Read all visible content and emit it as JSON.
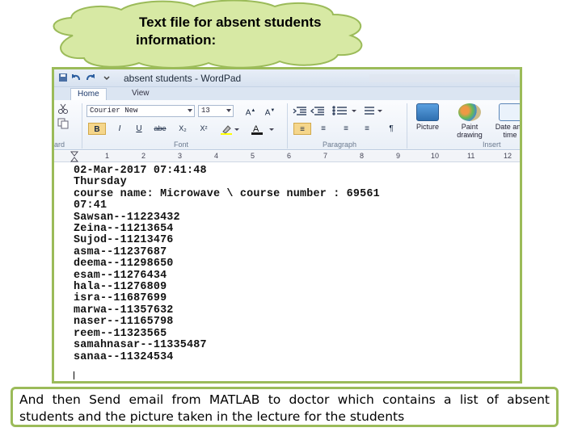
{
  "callout": {
    "title": "Text file for absent students information:"
  },
  "screenshot": {
    "window_title": "absent students - WordPad",
    "tabs": [
      "Home",
      "View"
    ],
    "font_name": "Courier New",
    "font_size": "13",
    "format_buttons": [
      "B",
      "I",
      "U",
      "abe",
      "X₂",
      "X²"
    ],
    "group_labels": {
      "clipboard": "ard",
      "font": "Font",
      "paragraph": "Paragraph",
      "insert": "Insert"
    },
    "insert_buttons": [
      "Picture",
      "Paint drawing",
      "Date and time"
    ],
    "ruler_numbers": [
      "1",
      "2",
      "3",
      "4",
      "5",
      "6",
      "7",
      "8",
      "9",
      "10",
      "11",
      "12"
    ],
    "document_lines": [
      "02-Mar-2017 07:41:48",
      "Thursday",
      "course name: Microwave \\ course number : 69561",
      "07:41",
      "Sawsan--11223432",
      "Zeina--11213654",
      "Sujod--11213476",
      "asma--11237687",
      "deema--11298650",
      "esam--11276434",
      "hala--11276809",
      "isra--11687699",
      "marwa--11357632",
      "naser--11165798",
      "reem--11323565",
      "samahnasar--11335487",
      "sanaa--11324534"
    ]
  },
  "caption": {
    "text": "And then Send email from MATLAB to doctor which contains a list of absent students and the picture taken in the lecture for the students"
  },
  "colors": {
    "cloud_fill": "#d7e9a4",
    "cloud_stroke": "#9bbb59",
    "frame_border": "#9bbb59"
  },
  "icons": [
    "undo-icon",
    "redo-icon",
    "save-icon",
    "cut-icon",
    "copy-icon",
    "paste-icon",
    "picture-icon",
    "paint-drawing-icon",
    "date-time-icon"
  ]
}
